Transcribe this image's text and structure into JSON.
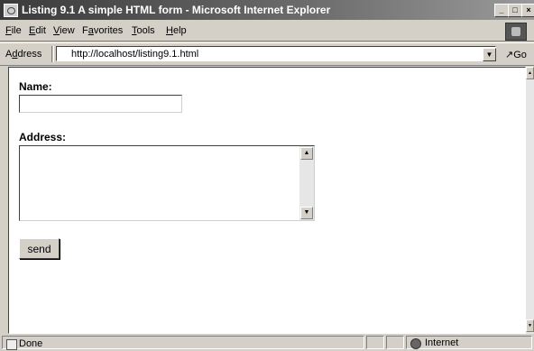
{
  "window": {
    "title": "Listing 9.1 A simple HTML form - Microsoft Internet Explorer",
    "controls": {
      "minimize": "_",
      "maximize": "□",
      "close": "×"
    }
  },
  "menu": {
    "items": [
      {
        "accel": "F",
        "rest": "ile"
      },
      {
        "accel": "E",
        "rest": "dit"
      },
      {
        "accel": "V",
        "rest": "iew"
      },
      {
        "pre": "F",
        "accel": "a",
        "rest": "vorites"
      },
      {
        "accel": "T",
        "rest": "ools"
      },
      {
        "accel": "H",
        "rest": "elp"
      }
    ]
  },
  "address_bar": {
    "label_accel": "d",
    "label_pre": "A",
    "label_rest": "dress",
    "url": "http://localhost/listing9.1.html",
    "go_label": "Go"
  },
  "form": {
    "name_label": "Name:",
    "name_value": "",
    "address_label": "Address:",
    "address_value": "",
    "send_label": "send"
  },
  "status": {
    "text": "Done",
    "zone": "Internet"
  },
  "icons": {
    "app": "ie-page-icon",
    "throbber": "windows-logo-icon",
    "status": "page-icon",
    "zone": "globe-icon"
  }
}
